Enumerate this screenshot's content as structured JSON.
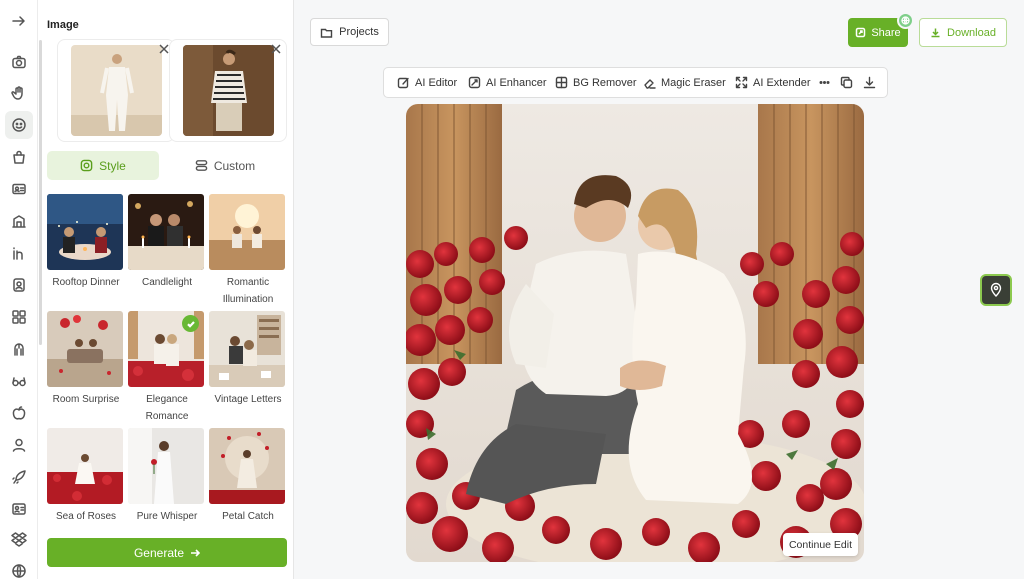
{
  "panel": {
    "title": "Image",
    "tabs": {
      "style": "Style",
      "custom": "Custom"
    },
    "styles": [
      {
        "label": "Rooftop Dinner",
        "selected": false
      },
      {
        "label": "Candlelight",
        "selected": false
      },
      {
        "label": "Romantic Illumination",
        "selected": false
      },
      {
        "label": "Room Surprise",
        "selected": false
      },
      {
        "label": "Elegance Romance",
        "selected": true
      },
      {
        "label": "Vintage Letters",
        "selected": false
      },
      {
        "label": "Sea of Roses",
        "selected": false
      },
      {
        "label": "Pure Whisper",
        "selected": false
      },
      {
        "label": "Petal Catch",
        "selected": false
      }
    ],
    "generate_label": "Generate"
  },
  "header": {
    "projects_label": "Projects",
    "share_label": "Share",
    "download_label": "Download"
  },
  "toolbar": {
    "ai_editor": "AI Editor",
    "ai_enhancer": "AI Enhancer",
    "bg_remover": "BG Remover",
    "magic_eraser": "Magic Eraser",
    "ai_extender": "AI Extender"
  },
  "canvas": {
    "continue_label": "Continue Edit"
  },
  "colors": {
    "accent": "#68b027",
    "accent_light": "#e8f3dd",
    "check": "#68b834"
  },
  "rail_icons": [
    "collapse-arrow-icon",
    "camera-icon",
    "hand-icon",
    "sticker-icon",
    "bag-icon",
    "id-card-icon",
    "building-icon",
    "linkedin-icon",
    "portrait-icon",
    "apps-icon",
    "hair-icon",
    "glasses-icon",
    "apple-icon",
    "person-icon",
    "rocket-icon",
    "contact-card-icon",
    "dropbox-icon",
    "globe-icon"
  ]
}
